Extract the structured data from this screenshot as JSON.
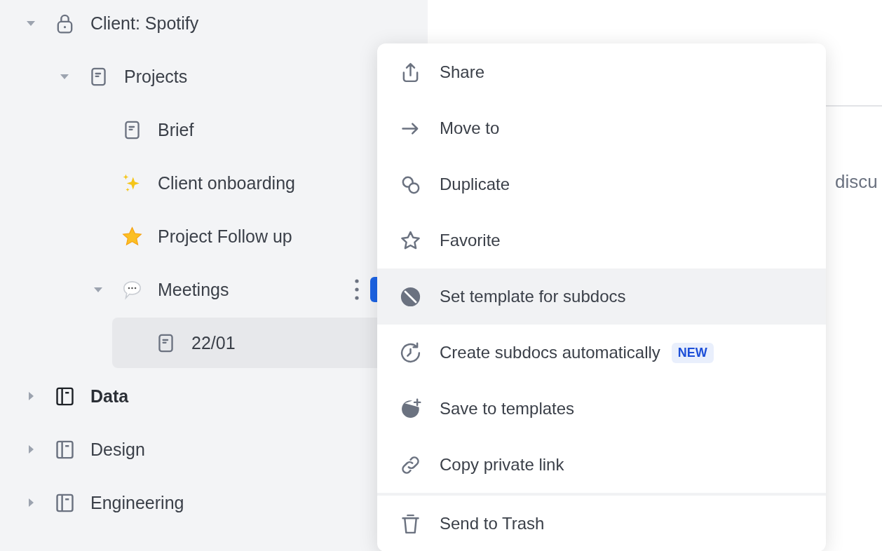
{
  "sidebar": {
    "tree": [
      {
        "label": "Client: Spotify",
        "kind": "private",
        "expanded": true,
        "selected": false,
        "current": false,
        "menu_open": false,
        "children": [
          {
            "label": "Projects",
            "kind": "page",
            "expanded": true,
            "selected": false,
            "current": false,
            "menu_open": false,
            "children": [
              {
                "label": "Brief",
                "kind": "page",
                "selected": false,
                "current": false,
                "menu_open": false
              },
              {
                "label": "Client onboarding",
                "kind": "sparkles",
                "selected": false,
                "current": false,
                "menu_open": false
              },
              {
                "label": "Project Follow up",
                "kind": "star",
                "selected": false,
                "current": false,
                "menu_open": false
              },
              {
                "label": "Meetings",
                "kind": "speech",
                "expanded": true,
                "selected": false,
                "current": false,
                "menu_open": true,
                "children": [
                  {
                    "label": "22/01",
                    "kind": "page",
                    "selected": true,
                    "current": false,
                    "menu_open": false
                  }
                ]
              }
            ]
          }
        ]
      },
      {
        "label": "Data",
        "kind": "space",
        "expanded": false,
        "selected": false,
        "current": true,
        "menu_open": false
      },
      {
        "label": "Design",
        "kind": "space",
        "expanded": false,
        "selected": false,
        "current": false,
        "menu_open": false
      },
      {
        "label": "Engineering",
        "kind": "space",
        "expanded": false,
        "selected": false,
        "current": false,
        "menu_open": false
      }
    ]
  },
  "main": {
    "text": "discu"
  },
  "context_menu": {
    "groups": [
      [
        {
          "label": "Share",
          "kind": "share",
          "selected": false
        },
        {
          "label": "Move to",
          "kind": "move",
          "selected": false
        },
        {
          "label": "Duplicate",
          "kind": "duplicate",
          "selected": false
        },
        {
          "label": "Favorite",
          "kind": "favorite",
          "selected": false
        },
        {
          "label": "Set template for subdocs",
          "kind": "template",
          "selected": true
        },
        {
          "label": "Create subdocs automatically",
          "kind": "auto",
          "selected": false,
          "badge": "NEW"
        },
        {
          "label": "Save to templates",
          "kind": "save",
          "selected": false
        },
        {
          "label": "Copy private link",
          "kind": "link",
          "selected": false
        }
      ],
      [
        {
          "label": "Send to Trash",
          "kind": "trash",
          "selected": false
        }
      ]
    ]
  }
}
